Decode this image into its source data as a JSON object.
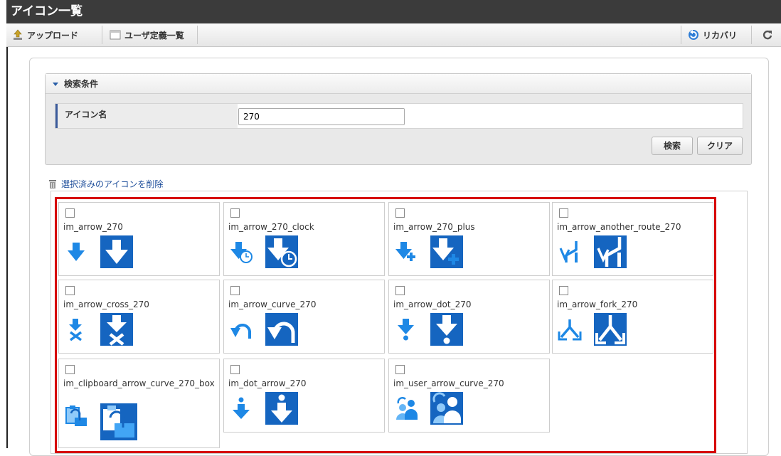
{
  "window": {
    "title": "アイコン一覧"
  },
  "toolbar": {
    "upload_label": "アップロード",
    "user_defined_label": "ユーザ定義一覧",
    "recovery_label": "リカバリ"
  },
  "search": {
    "header_label": "検索条件",
    "field_label": "アイコン名",
    "field_value": "270",
    "search_button": "検索",
    "clear_button": "クリア"
  },
  "actions": {
    "delete_selected_label": "選択済みのアイコンを削除"
  },
  "icons": [
    {
      "name": "im_arrow_270",
      "glyph": "arrow-down"
    },
    {
      "name": "im_arrow_270_clock",
      "glyph": "arrow-clock"
    },
    {
      "name": "im_arrow_270_plus",
      "glyph": "arrow-plus"
    },
    {
      "name": "im_arrow_another_route_270",
      "glyph": "another-route"
    },
    {
      "name": "im_arrow_cross_270",
      "glyph": "arrow-cross"
    },
    {
      "name": "im_arrow_curve_270",
      "glyph": "arrow-curve"
    },
    {
      "name": "im_arrow_dot_270",
      "glyph": "arrow-dot"
    },
    {
      "name": "im_arrow_fork_270",
      "glyph": "arrow-fork"
    },
    {
      "name": "im_clipboard_arrow_curve_270_box",
      "glyph": "clipboard"
    },
    {
      "name": "im_dot_arrow_270",
      "glyph": "dot-arrow"
    },
    {
      "name": "im_user_arrow_curve_270",
      "glyph": "user-arrow"
    }
  ],
  "colors": {
    "accent": "#1565c0",
    "highlight_border": "#d60000",
    "titlebar": "#3b3b3b"
  }
}
